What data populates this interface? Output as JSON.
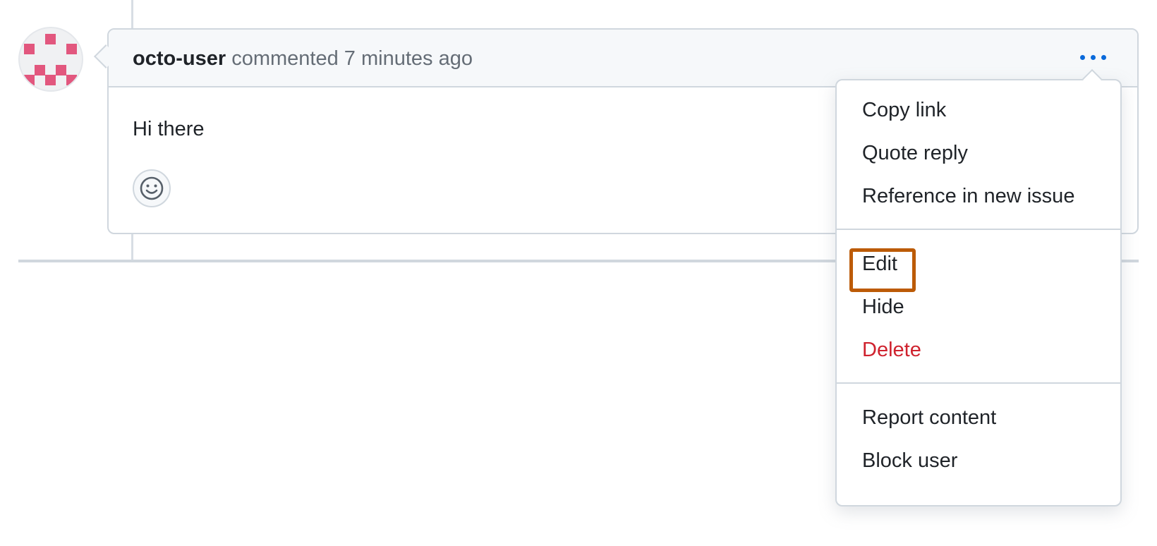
{
  "comment": {
    "author": "octo-user",
    "action": "commented",
    "timestamp": "7 minutes ago",
    "body": "Hi there"
  },
  "icons": {
    "avatar": "identicon-avatar",
    "more_options": "kebab-horizontal-icon",
    "reaction": "smiley-icon"
  },
  "menu": {
    "groups": [
      {
        "items": [
          {
            "label": "Copy link"
          },
          {
            "label": "Quote reply"
          },
          {
            "label": "Reference in new issue"
          }
        ]
      },
      {
        "items": [
          {
            "label": "Edit"
          },
          {
            "label": "Hide"
          },
          {
            "label": "Delete"
          }
        ]
      },
      {
        "items": [
          {
            "label": "Report content"
          },
          {
            "label": "Block user"
          }
        ]
      }
    ],
    "highlighted_item": "Edit"
  },
  "colors": {
    "link_accent": "#0969da",
    "danger": "#cf222e",
    "highlight": "#bc5b07",
    "avatar_accent": "#e2577e"
  }
}
